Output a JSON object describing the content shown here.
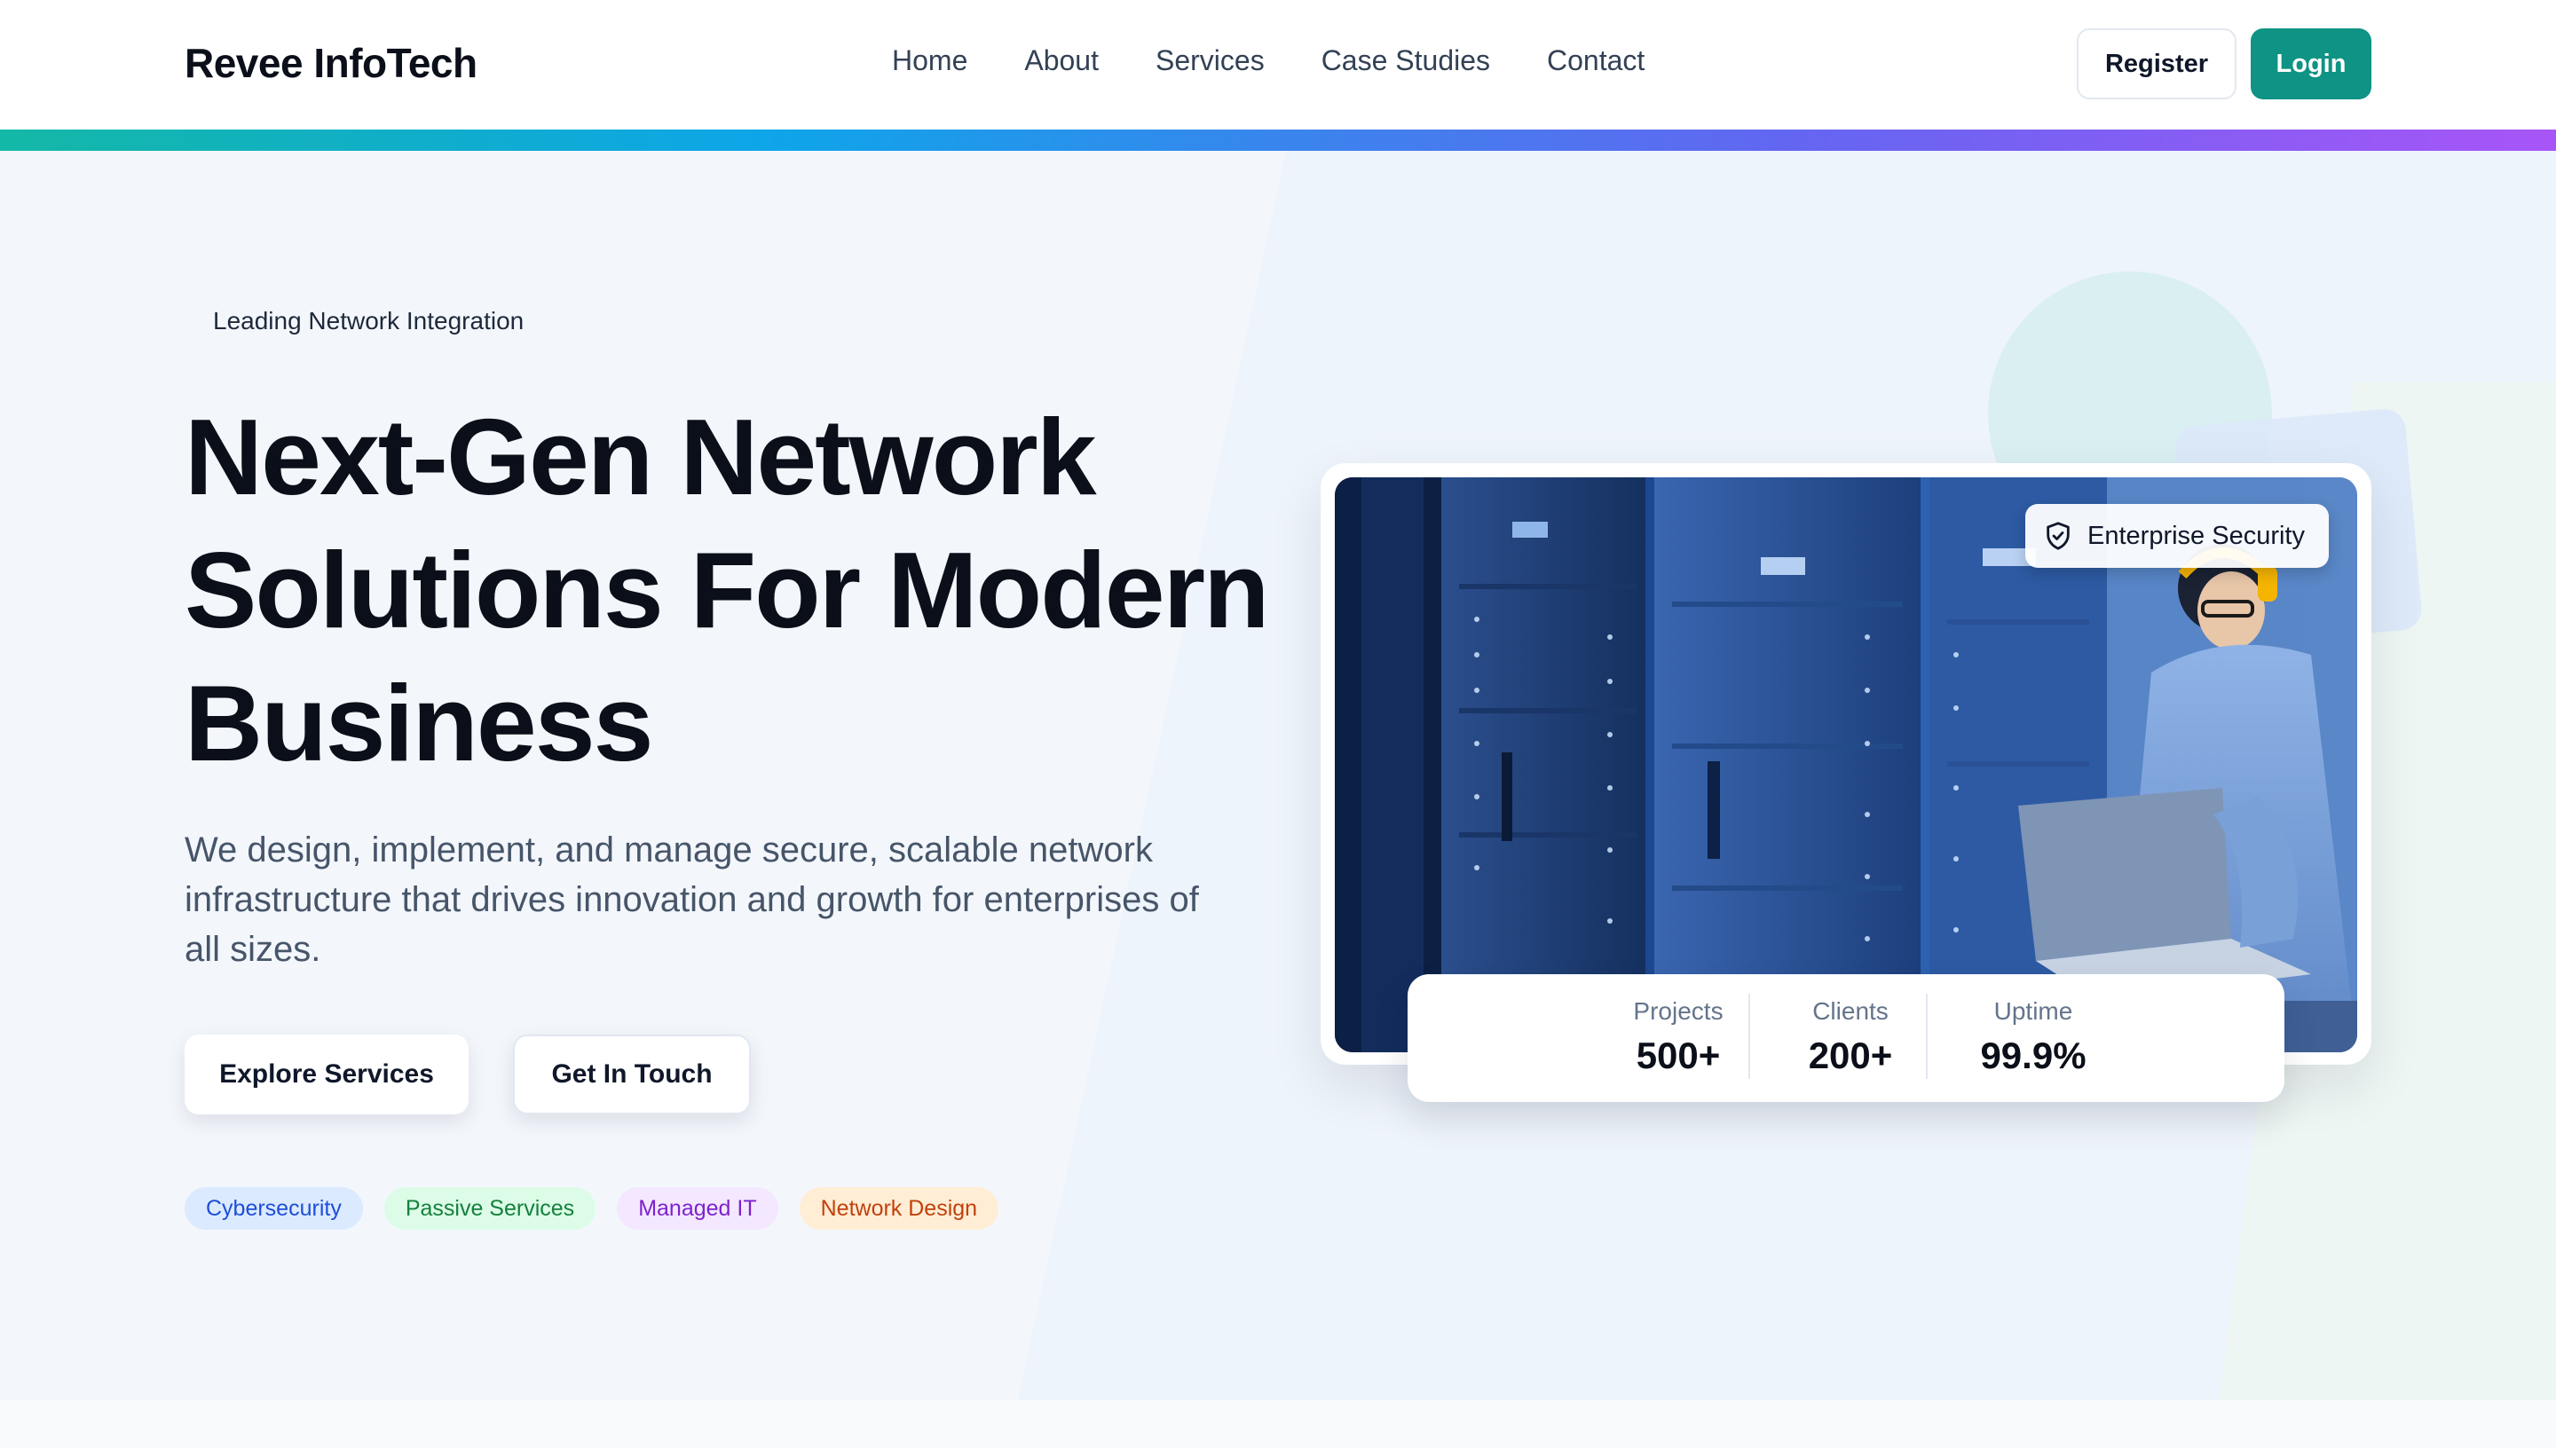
{
  "brand": {
    "name": "Revee InfoTech"
  },
  "nav": {
    "links": [
      "Home",
      "About",
      "Services",
      "Case Studies",
      "Contact"
    ],
    "register_label": "Register",
    "login_label": "Login"
  },
  "hero": {
    "tagline": "Leading Network Integration",
    "headline_lines": [
      "Next-Gen Network",
      "Solutions For Modern",
      "Business"
    ],
    "subtext": "We design, implement, and manage secure, scalable network infrastructure that drives innovation and growth for enterprises of all sizes.",
    "explore_label": "Explore Services",
    "touch_label": "Get In Touch",
    "chips": [
      "Cybersecurity",
      "Passive Services",
      "Managed IT",
      "Network Design"
    ]
  },
  "card": {
    "badge_text": "Enterprise Security",
    "badge_icon": "shield-check-icon",
    "stats": [
      {
        "label": "Projects",
        "value": "500+"
      },
      {
        "label": "Clients",
        "value": "200+"
      },
      {
        "label": "Uptime",
        "value": "99.9%"
      }
    ]
  },
  "colors": {
    "accent": "#0e9384",
    "gradient": [
      "#14b8a6",
      "#0ea5e9",
      "#6366f1",
      "#a855f7"
    ],
    "chip_blue": "#dbeafe",
    "chip_green": "#dcfce7",
    "chip_purple": "#f3e8ff",
    "chip_orange": "#ffedd5"
  }
}
